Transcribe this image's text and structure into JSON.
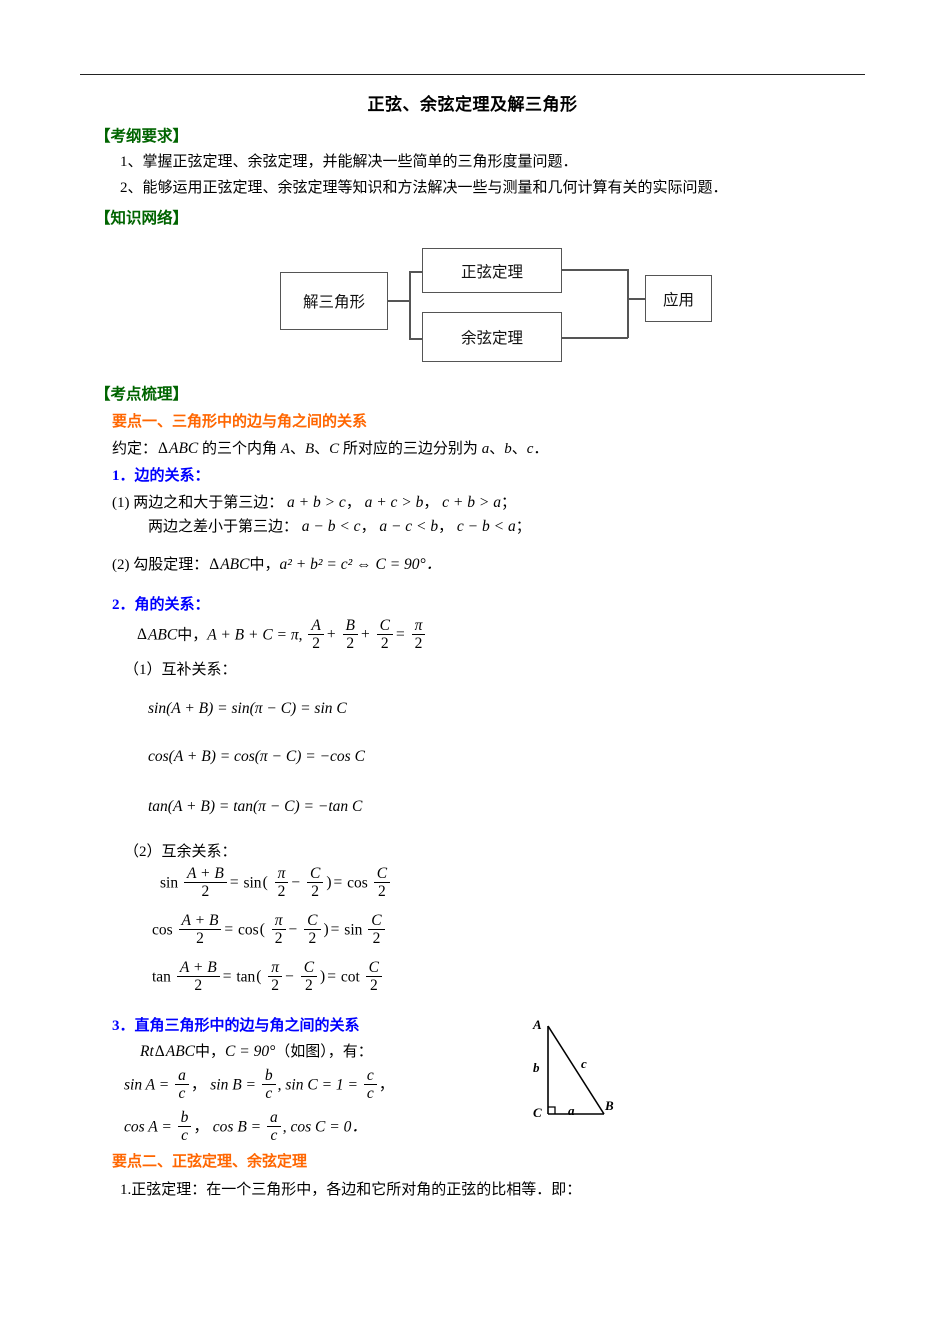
{
  "document": {
    "title": "正弦、余弦定理及解三角形"
  },
  "sections": {
    "outline": {
      "heading": "【考纲要求】",
      "items": [
        "1、掌握正弦定理、余弦定理，并能解决一些简单的三角形度量问题．",
        "2、能够运用正弦定理、余弦定理等知识和方法解决一些与测量和几何计算有关的实际问题．"
      ]
    },
    "network": {
      "heading": "【知识网络】",
      "nodes": {
        "root": "解三角形",
        "branch_top": "正弦定理",
        "branch_bottom": "余弦定理",
        "leaf": "应用"
      }
    },
    "review": {
      "heading": "【考点梳理】",
      "keypoint1": {
        "title": "要点一、三角形中的边与角之间的关系",
        "convention": {
          "lead": "约定：",
          "tri": "ABC",
          "mid": " 的三个内角 ",
          "angles": [
            "A",
            "B",
            "C"
          ],
          "tail": " 所对应的三边分别为 ",
          "sides": [
            "a",
            "b",
            "c"
          ],
          "period": "．"
        },
        "sides_relation": {
          "heading": "1．边的关系：",
          "item1_label": "(1)  两边之和大于第三边：",
          "item1_formulas": [
            "a + b > c",
            "a + c > b",
            "c + b > a"
          ],
          "item1b_label": "两边之差小于第三边：",
          "item1b_formulas": [
            "a − b < c",
            "a − c < b",
            "c − b < a"
          ],
          "item2_label": "(2)  勾股定理：",
          "item2_tri": "ABC",
          "item2_mid": "中，",
          "item2_formula": "a² + b² = c² ⇔ C = 90°．"
        },
        "angles_relation": {
          "heading": "2．角的关系：",
          "sum_line": {
            "tri": "ABC",
            "mid": "中，",
            "eq1": "A + B + C = π",
            "comma": ",",
            "eq2_parts": [
              "A",
              "2",
              "B",
              "2",
              "C",
              "2",
              "π",
              "2"
            ]
          },
          "supplementary": {
            "label": "（1）互补关系：",
            "formulas": [
              "sin(A + B) = sin(π − C) = sin C",
              "cos(A + B) = cos(π − C) = −cos C",
              "tan(A + B) = tan(π − C) = −tan C"
            ]
          },
          "complementary": {
            "label": "（2）互余关系：",
            "rows": [
              {
                "fn": "sin",
                "num": "A + B",
                "den": "2",
                "fn2": "sin",
                "pnum": "π",
                "pden": "2",
                "cnum": "C",
                "cden": "2",
                "fn3": "cos",
                "rnum": "C",
                "rden": "2"
              },
              {
                "fn": "cos",
                "num": "A + B",
                "den": "2",
                "fn2": "cos",
                "pnum": "π",
                "pden": "2",
                "cnum": "C",
                "cden": "2",
                "fn3": "sin",
                "rnum": "C",
                "rden": "2"
              },
              {
                "fn": "tan",
                "num": "A + B",
                "den": "2",
                "fn2": "tan",
                "pnum": "π",
                "pden": "2",
                "cnum": "C",
                "cden": "2",
                "fn3": "cot",
                "rnum": "C",
                "rden": "2"
              }
            ]
          }
        },
        "right_triangle": {
          "heading": "3．直角三角形中的边与角之间的关系",
          "lead": {
            "rt": "Rt",
            "tri": "ABC",
            "mid": "中，",
            "cond": "C = 90°",
            "note": "（如图），有："
          },
          "sin_row": {
            "s1_fn": "sin A =",
            "s1_num": "a",
            "s1_den": "c",
            "s2_fn": "sin B =",
            "s2_num": "b",
            "s2_den": "c",
            "s3_fn": "sin C = 1 =",
            "s3_num": "c",
            "s3_den": "c",
            "tail": "，"
          },
          "cos_row": {
            "c1_fn": "cos A =",
            "c1_num": "b",
            "c1_den": "c",
            "c2_fn": "cos B =",
            "c2_num": "a",
            "c2_den": "c",
            "c3": "cos C = 0．"
          },
          "figure": {
            "vertex_a": "A",
            "vertex_b": "B",
            "vertex_c": "C",
            "side_a": "a",
            "side_b": "b",
            "side_c": "c"
          }
        }
      },
      "keypoint2": {
        "title": "要点二、正弦定理、余弦定理",
        "item1": "1.正弦定理：在一个三角形中，各边和它所对角的正弦的比相等．即："
      }
    }
  },
  "colors": {
    "section_heading": "#006400",
    "keypoint": "#FF6600",
    "numbered": "#0000FF",
    "body": "#000000",
    "diagram_border": "#555555"
  }
}
